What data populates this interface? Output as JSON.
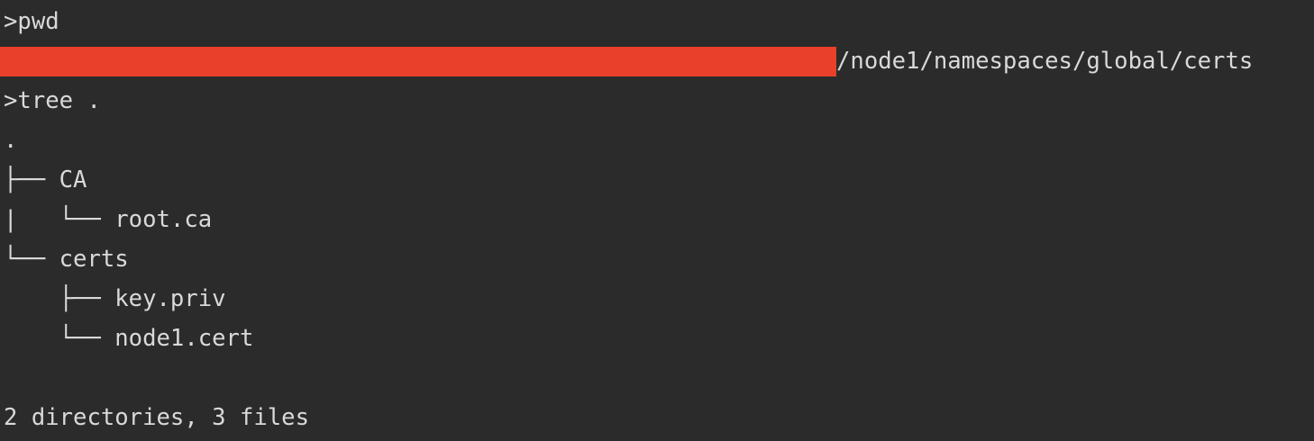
{
  "terminal": {
    "lines": {
      "prompt_pwd": ">pwd",
      "pwd_path_suffix": "/node1/namespaces/global/certs",
      "prompt_tree": ">tree .",
      "tree_root": ".",
      "tree_ca": "├── CA",
      "tree_root_ca": "|   └── root.ca",
      "tree_certs": "└── certs",
      "tree_key_priv": "    ├── key.priv",
      "tree_node1_cert": "    └── node1.cert",
      "summary": "2 directories, 3 files"
    },
    "redaction_color": "#e8402a",
    "background_color": "#2b2b2b",
    "text_color": "#d9d9d9"
  }
}
